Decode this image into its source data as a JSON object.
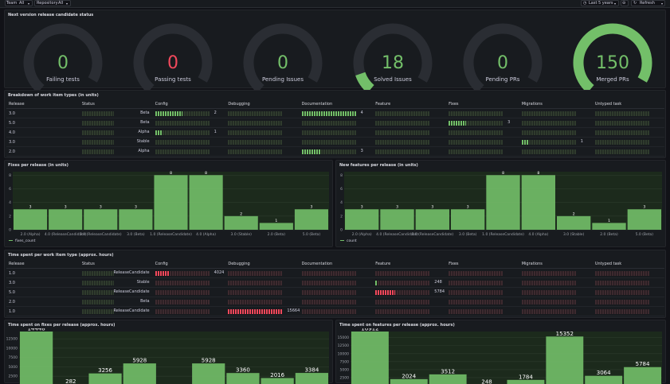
{
  "toolbar": {
    "team_label": "Team",
    "team_value": "All",
    "repo_label": "Repository",
    "repo_value": "All",
    "time_range": "Last 5 years",
    "refresh_label": "Refresh"
  },
  "colors": {
    "green": "#73bf69",
    "red": "#f2495c",
    "track": "#2a2d33"
  },
  "stats_panel": {
    "title": "Next version release candidate status",
    "gauges": [
      {
        "value": "0",
        "label": "Failing tests",
        "color": "#73bf69",
        "fraction": 0
      },
      {
        "value": "0",
        "label": "Passing tests",
        "color": "#f2495c",
        "fraction": 0
      },
      {
        "value": "0",
        "label": "Pending Issues",
        "color": "#73bf69",
        "fraction": 0
      },
      {
        "value": "18",
        "label": "Solved Issues",
        "color": "#73bf69",
        "fraction": 0.12
      },
      {
        "value": "0",
        "label": "Pending PRs",
        "color": "#73bf69",
        "fraction": 0
      },
      {
        "value": "150",
        "label": "Merged PRs",
        "color": "#73bf69",
        "fraction": 1
      }
    ]
  },
  "breakdown_table": {
    "title": "Breakdown of work item types (in units)",
    "columns": [
      "Release",
      "Status",
      "Config",
      "Debugging",
      "Documentation",
      "Feature",
      "Fixes",
      "Migrations",
      "Untyped task"
    ],
    "rows": [
      {
        "release": "3.0",
        "status": "Beta",
        "cells": [
          "2",
          "",
          "4",
          "",
          "",
          "",
          ""
        ],
        "fills": [
          0.5,
          0,
          1,
          0,
          0,
          0,
          0
        ]
      },
      {
        "release": "5.0",
        "status": "Beta",
        "cells": [
          "",
          "",
          "",
          "",
          "3",
          "",
          ""
        ],
        "fills": [
          0,
          0,
          0,
          0,
          0.33,
          0,
          0
        ]
      },
      {
        "release": "4.0",
        "status": "Alpha",
        "cells": [
          "1",
          "",
          "",
          "",
          "",
          "",
          ""
        ],
        "fills": [
          0.12,
          0,
          0,
          0,
          0,
          0,
          0
        ]
      },
      {
        "release": "3.0",
        "status": "Stable",
        "cells": [
          "",
          "",
          "",
          "",
          "",
          "1",
          ""
        ],
        "fills": [
          0,
          0,
          0,
          0,
          0,
          0.12,
          0
        ]
      },
      {
        "release": "2.0",
        "status": "Alpha",
        "cells": [
          "",
          "",
          "3",
          "",
          "",
          "",
          ""
        ],
        "fills": [
          0,
          0,
          0.35,
          0,
          0,
          0,
          0
        ]
      }
    ]
  },
  "time_table": {
    "title": "Time spent per work item type (approx. hours)",
    "columns": [
      "Release",
      "Status",
      "Config",
      "Debugging",
      "Documentation",
      "Feature",
      "Fixes",
      "Migrations",
      "Untyped task"
    ],
    "rows": [
      {
        "release": "1.0",
        "status": "ReleaseCandidate",
        "cells": [
          "4024",
          "",
          "",
          "",
          "",
          "",
          ""
        ],
        "fills": [
          0.26,
          0,
          0,
          0,
          0,
          0,
          0
        ],
        "colors": [
          "red",
          "",
          "",
          "",
          "",
          "",
          ""
        ]
      },
      {
        "release": "3.0",
        "status": "Stable",
        "cells": [
          "",
          "",
          "",
          "248",
          "",
          "",
          ""
        ],
        "fills": [
          0,
          0,
          0,
          0.04,
          0,
          0,
          0
        ],
        "colors": [
          "",
          "",
          "",
          "green",
          "",
          "",
          ""
        ]
      },
      {
        "release": "5.0",
        "status": "ReleaseCandidate",
        "cells": [
          "",
          "",
          "",
          "5784",
          "",
          "",
          ""
        ],
        "fills": [
          0,
          0,
          0,
          0.37,
          0,
          0,
          0
        ],
        "colors": [
          "",
          "",
          "",
          "red",
          "",
          "",
          ""
        ]
      },
      {
        "release": "2.0",
        "status": "Beta",
        "cells": [
          "",
          "",
          "",
          "",
          "",
          "",
          ""
        ],
        "fills": [
          0,
          0,
          0,
          0,
          0,
          0,
          0
        ],
        "colors": [
          "",
          "",
          "",
          "",
          "",
          "",
          ""
        ]
      },
      {
        "release": "1.0",
        "status": "ReleaseCandidate",
        "cells": [
          "",
          "15664",
          "",
          "",
          "",
          "",
          ""
        ],
        "fills": [
          0,
          1,
          0,
          0,
          0,
          0,
          0
        ],
        "colors": [
          "",
          "red",
          "",
          "",
          "",
          "",
          ""
        ]
      }
    ]
  },
  "chart_data": [
    {
      "type": "bar",
      "title": "Fixes per release (in units)",
      "categories": [
        "2.0 (Alpha)",
        "4.0 (ReleaseCandidate)",
        "5.0 (ReleaseCandidate)",
        "3.0 (Beta)",
        "1.0 (ReleaseCandidate)",
        "4.0 (Alpha)",
        "3.0 (Stable)",
        "2.0 (Beta)",
        "5.0 (Beta)"
      ],
      "series": [
        {
          "name": "fixes_count",
          "values": [
            3,
            3,
            3,
            3,
            8,
            8,
            2,
            1,
            3
          ]
        }
      ],
      "yticks": [
        0,
        2,
        4,
        6,
        8
      ],
      "ylim": [
        0,
        8.5
      ],
      "grid": true,
      "legend": "bottom-left"
    },
    {
      "type": "bar",
      "title": "New features per release (in units)",
      "categories": [
        "2.0 (Alpha)",
        "4.0 (ReleaseCandidate)",
        "5.0 (ReleaseCandidate)",
        "3.0 (Beta)",
        "1.0 (ReleaseCandidate)",
        "4.0 (Alpha)",
        "3.0 (Stable)",
        "2.0 (Beta)",
        "5.0 (Beta)"
      ],
      "series": [
        {
          "name": "count",
          "values": [
            3,
            3,
            3,
            3,
            8,
            8,
            2,
            1,
            3
          ]
        }
      ],
      "yticks": [
        0,
        2,
        4,
        6,
        8
      ],
      "ylim": [
        0,
        8.5
      ],
      "grid": true,
      "legend": "bottom-left"
    },
    {
      "type": "bar",
      "title": "Time spent on fixes per release (approx. hours)",
      "categories": [
        "",
        "",
        "",
        "",
        "",
        "",
        "",
        "",
        ""
      ],
      "series": [
        {
          "values": [
            14448,
            282,
            3256,
            5928,
            0,
            5928,
            3360,
            2016,
            3384
          ]
        }
      ],
      "labels": [
        "14448",
        "282",
        "3256",
        "5928",
        "",
        "5928",
        "3360",
        "2016",
        "3384"
      ],
      "yticks": [
        2500,
        5000,
        7500,
        10000,
        12500
      ],
      "ytick_labels": [
        "2500",
        "5000",
        "7500",
        "10000",
        "12500"
      ],
      "ylim": [
        0,
        14448
      ],
      "grid": true
    },
    {
      "type": "bar",
      "title": "Time spent on features per release (approx. hours)",
      "categories": [
        "",
        "",
        "",
        "",
        "",
        "",
        "",
        "",
        ""
      ],
      "series": [
        {
          "values": [
            16912,
            2024,
            3512,
            248,
            1784,
            15352,
            3064,
            5784
          ]
        }
      ],
      "labels": [
        "16912",
        "2024",
        "3512",
        "248",
        "1784",
        "15352",
        "3064",
        "5784"
      ],
      "yticks": [
        2500,
        5000,
        7500,
        10000,
        12500,
        15000
      ],
      "ytick_labels": [
        "2500",
        "5000",
        "7500",
        "10000",
        "12500",
        "15000"
      ],
      "ylim": [
        0,
        16912
      ],
      "grid": true
    }
  ]
}
